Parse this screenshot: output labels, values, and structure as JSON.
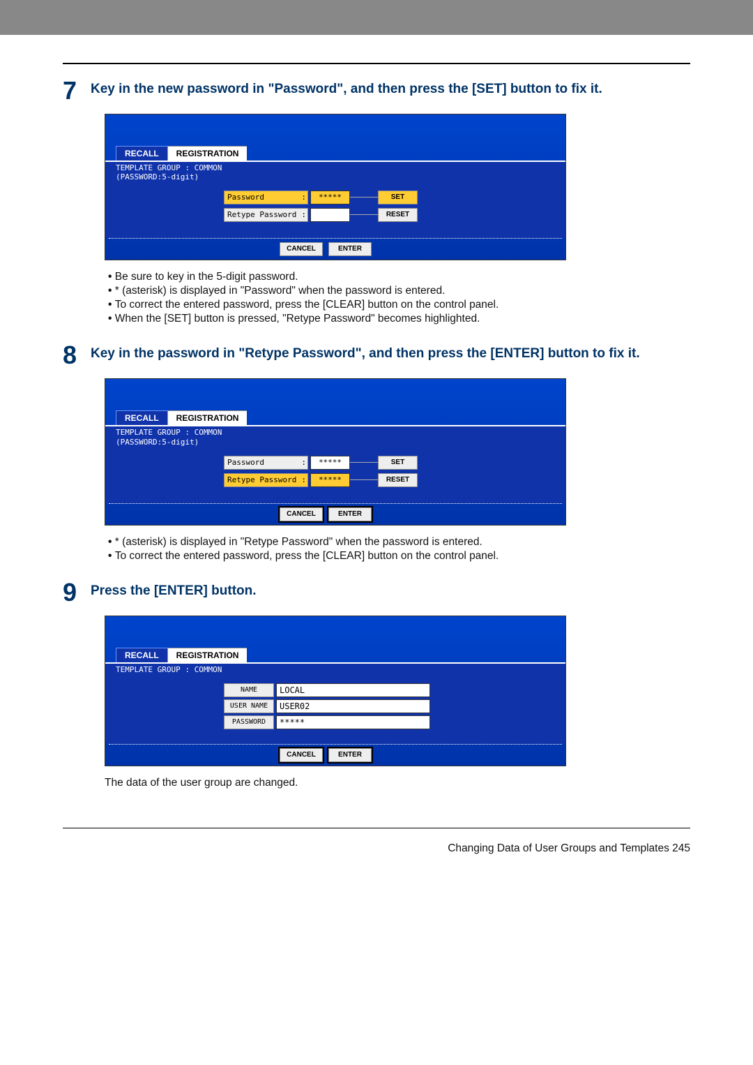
{
  "steps": {
    "s7": {
      "num": "7",
      "title": "Key in the new password in \"Password\", and then press the [SET] button to fix it.",
      "bullets": [
        "Be sure to key in the 5-digit password.",
        "* (asterisk) is displayed in \"Password\" when the password is entered.",
        "To correct the entered password, press the [CLEAR] button on the control panel.",
        "When the [SET] button is pressed, \"Retype Password\" becomes highlighted."
      ]
    },
    "s8": {
      "num": "8",
      "title": "Key in the password in \"Retype Password\", and then press the [ENTER] button to fix it.",
      "bullets": [
        "* (asterisk) is displayed in \"Retype Password\" when the password is entered.",
        "To correct the entered password, press the [CLEAR] button on the control panel."
      ]
    },
    "s9": {
      "num": "9",
      "title": "Press the [ENTER] button.",
      "note": "The data of the user group are changed."
    }
  },
  "ui": {
    "tab_recall": "RECALL",
    "tab_registration": "REGISTRATION",
    "template_line1": "TEMPLATE GROUP   : COMMON",
    "template_line2": "(PASSWORD:5-digit)",
    "password_label": "Password",
    "retype_label": "Retype Password",
    "asterisks": "*****",
    "set_btn": "SET",
    "reset_btn": "RESET",
    "cancel_btn": "CANCEL",
    "enter_btn": "ENTER",
    "name_label": "NAME",
    "username_label": "USER NAME",
    "password_btn_label": "PASSWORD",
    "name_value": "LOCAL",
    "username_value": "USER02",
    "password_value": "*****"
  },
  "footer": {
    "text": "Changing Data of User Groups and Templates    245"
  }
}
